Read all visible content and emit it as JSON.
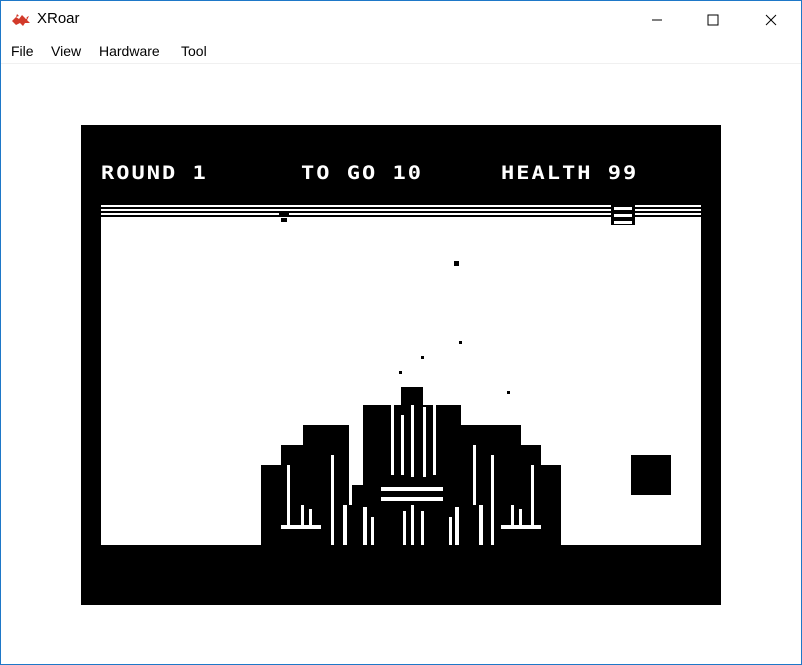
{
  "window": {
    "title": "XRoar",
    "minimize_icon": "minimize-icon",
    "maximize_icon": "maximize-icon",
    "close_icon": "close-icon",
    "app_icon": "dragon-icon"
  },
  "menu": {
    "items": [
      {
        "label": "File"
      },
      {
        "label": "View"
      },
      {
        "label": "Hardware"
      },
      {
        "label": "Tool"
      }
    ]
  },
  "game": {
    "round_label": "ROUND 1",
    "togo_label": "TO GO 10",
    "health_label": "HEALTH 99",
    "colors": {
      "background": "#000000",
      "foreground": "#ffffff",
      "border": "#1e78c8"
    }
  }
}
